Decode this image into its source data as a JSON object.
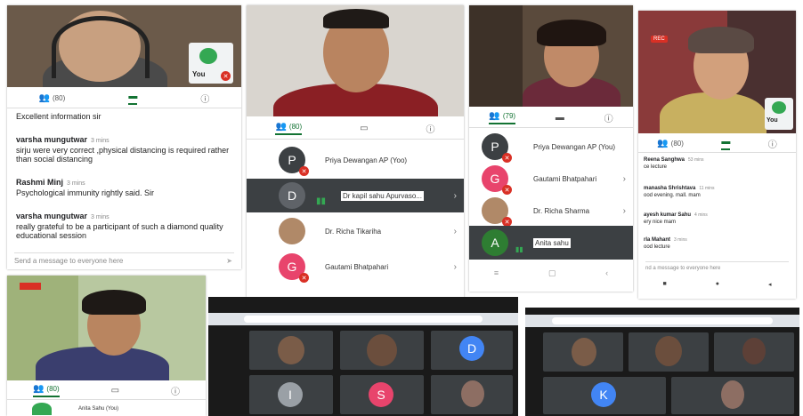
{
  "colors": {
    "meet_green": "#137333",
    "mic_red": "#d93025",
    "tab_text": "#555555"
  },
  "panel1": {
    "self_label": "You",
    "tabs": [
      {
        "label": "(80)",
        "icon": "people-icon"
      },
      {
        "label": "",
        "icon": "chat-icon"
      },
      {
        "label": "",
        "icon": "info-icon"
      }
    ],
    "messages": [
      {
        "author": "",
        "time": "",
        "text": "Excellent information sir"
      },
      {
        "author": "varsha mungutwar",
        "time": "3 mins",
        "text": "sirju were very correct ,physical distancing is required rather than social distancing"
      },
      {
        "author": "Rashmi Minj",
        "time": "3 mins",
        "text": "Psychological immunity rightly said. Sir"
      },
      {
        "author": "varsha mungutwar",
        "time": "3 mins",
        "text": "really grateful to be a participant of such a diamond quality educational session"
      }
    ],
    "input_placeholder": "Send a message to everyone here"
  },
  "panel2": {
    "tabs": [
      {
        "label": "(80)",
        "icon": "people-icon"
      },
      {
        "label": "",
        "icon": "present-icon"
      },
      {
        "label": "",
        "icon": "info-icon"
      }
    ],
    "participants": [
      {
        "initial": "P",
        "name": "Priya Dewangan AP (Yoo)",
        "color": "#3c4043"
      },
      {
        "initial": "D",
        "name": "Dr kapil sahu Apurvaso...",
        "color": "#5f6368"
      },
      {
        "initial": "",
        "name": "Dr. Richa Tikariha",
        "color": "#b08968"
      },
      {
        "initial": "G",
        "name": "Gautami Bhatpahari",
        "color": "#e8446c"
      }
    ]
  },
  "panel3": {
    "tabs": [
      {
        "label": "(79)",
        "icon": "people-icon"
      },
      {
        "label": "",
        "icon": "chat-icon"
      },
      {
        "label": "",
        "icon": "info-icon"
      }
    ],
    "participants": [
      {
        "initial": "P",
        "name": "Priya Dewangan AP (You)",
        "color": "#3c4043"
      },
      {
        "initial": "G",
        "name": "Gautami Bhatpahari",
        "color": "#e8446c"
      },
      {
        "initial": "",
        "name": "Dr. Richa Sharma",
        "color": "#b08968"
      },
      {
        "initial": "A",
        "name": "Anita sahu",
        "color": "#2e7d32"
      }
    ]
  },
  "panel4": {
    "rec_label": "REC",
    "self_label": "You",
    "tabs": [
      {
        "label": "(80)",
        "icon": "people-icon"
      },
      {
        "label": "",
        "icon": "chat-icon"
      },
      {
        "label": "",
        "icon": "info-icon"
      }
    ],
    "messages": [
      {
        "author": "Reena Sanghwa",
        "time": "53 mins",
        "text": "ce lecture"
      },
      {
        "author": "manasha Shrishtava",
        "time": "11 mins",
        "text": "ood evening. mall. mam"
      },
      {
        "author": "ayesh kumar Sahu",
        "time": "4 mins",
        "text": "ery nice mam"
      },
      {
        "author": "rla Mahant",
        "time": "3 mins",
        "text": "ood lecture"
      }
    ],
    "input_placeholder": "nd a message to everyone here"
  },
  "panel5": {
    "tabs": [
      {
        "label": "(80)",
        "icon": "people-icon"
      },
      {
        "label": "",
        "icon": "present-icon"
      },
      {
        "label": "",
        "icon": "info-icon"
      }
    ],
    "first_participant": "Anita Sahu (You)"
  },
  "laptop1": {
    "tiles": [
      {
        "initial": "",
        "color": "#7a5c48"
      },
      {
        "initial": "",
        "color": "#6b4e3d"
      },
      {
        "initial": "D",
        "color": "#4285f4"
      },
      {
        "initial": "I",
        "color": "#9aa0a6"
      },
      {
        "initial": "S",
        "color": "#e8446c"
      },
      {
        "initial": "",
        "color": "#8d6e63"
      }
    ]
  },
  "laptop2": {
    "tiles": [
      {
        "initial": "",
        "color": "#7a5c48"
      },
      {
        "initial": "",
        "color": "#6b4e3d"
      },
      {
        "initial": "",
        "color": "#5d4037"
      },
      {
        "initial": "K",
        "color": "#4285f4"
      },
      {
        "initial": "",
        "color": "#8d6e63"
      }
    ]
  }
}
